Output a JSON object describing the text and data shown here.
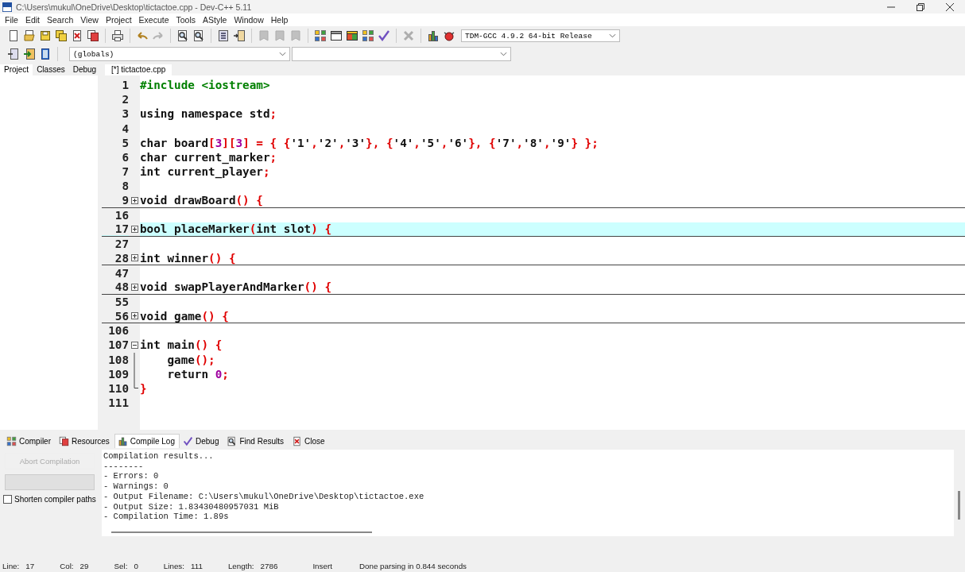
{
  "window": {
    "title": "C:\\Users\\mukul\\OneDrive\\Desktop\\tictactoe.cpp - Dev-C++ 5.11"
  },
  "menu": [
    "File",
    "Edit",
    "Search",
    "View",
    "Project",
    "Execute",
    "Tools",
    "AStyle",
    "Window",
    "Help"
  ],
  "toolbar": [
    {
      "kind": "page",
      "disabled": false
    },
    {
      "kind": "open",
      "disabled": false
    },
    {
      "kind": "save",
      "disabled": false
    },
    {
      "kind": "saveall",
      "disabled": false
    },
    {
      "kind": "closefile",
      "disabled": false
    },
    {
      "kind": "closeall",
      "disabled": false
    },
    {
      "kind": "sep"
    },
    {
      "kind": "print",
      "disabled": false
    },
    {
      "kind": "sep"
    },
    {
      "kind": "undo",
      "disabled": false
    },
    {
      "kind": "redo",
      "disabled": true
    },
    {
      "kind": "sep"
    },
    {
      "kind": "find",
      "disabled": false
    },
    {
      "kind": "find",
      "disabled": false
    },
    {
      "kind": "sep"
    },
    {
      "kind": "lines",
      "disabled": false
    },
    {
      "kind": "indent",
      "disabled": false
    },
    {
      "kind": "sep"
    },
    {
      "kind": "tag",
      "disabled": true
    },
    {
      "kind": "tag",
      "disabled": true
    },
    {
      "kind": "tag",
      "disabled": true
    },
    {
      "kind": "sep"
    },
    {
      "kind": "grid",
      "disabled": false
    },
    {
      "kind": "window",
      "disabled": false
    },
    {
      "kind": "colorwindow",
      "disabled": false
    },
    {
      "kind": "grid",
      "disabled": false
    },
    {
      "kind": "check",
      "disabled": false
    },
    {
      "kind": "sep"
    },
    {
      "kind": "cross",
      "disabled": true
    },
    {
      "kind": "sep"
    },
    {
      "kind": "chart",
      "disabled": false
    },
    {
      "kind": "bug",
      "disabled": false
    }
  ],
  "compiler_select": {
    "value": "TDM-GCC 4.9.2 64-bit Release"
  },
  "toolbar2": [
    {
      "kind": "insert",
      "disabled": false
    },
    {
      "kind": "goto",
      "disabled": false
    },
    {
      "kind": "bookmark",
      "disabled": false
    }
  ],
  "scope_select": {
    "value": "(globals)"
  },
  "left_tabs": [
    {
      "label": "Project",
      "selected": true
    },
    {
      "label": "Classes",
      "selected": false
    },
    {
      "label": "Debug",
      "selected": false
    }
  ],
  "editor_tabs": [
    {
      "label": "[*] tictactoe.cpp",
      "selected": true
    }
  ],
  "code": [
    {
      "n": "1",
      "current": false,
      "seg": [
        {
          "kind": "pre",
          "t": "#include <iostream>"
        }
      ]
    },
    {
      "n": "2",
      "current": false
    },
    {
      "n": "3",
      "current": false,
      "seg": [
        {
          "kind": "plain",
          "t": "using namespace std"
        },
        {
          "kind": "sym",
          "t": ";"
        }
      ]
    },
    {
      "n": "4",
      "current": false
    },
    {
      "n": "5",
      "current": false,
      "seg": [
        {
          "kind": "plain",
          "t": "char board"
        },
        {
          "kind": "sym",
          "t": "["
        },
        {
          "kind": "num",
          "t": "3"
        },
        {
          "kind": "sym",
          "t": "]["
        },
        {
          "kind": "num",
          "t": "3"
        },
        {
          "kind": "sym",
          "t": "] = { {"
        },
        {
          "kind": "plain",
          "t": "'1'"
        },
        {
          "kind": "sym",
          "t": ","
        },
        {
          "kind": "plain",
          "t": "'2'"
        },
        {
          "kind": "sym",
          "t": ","
        },
        {
          "kind": "plain",
          "t": "'3'"
        },
        {
          "kind": "sym",
          "t": "}, {"
        },
        {
          "kind": "plain",
          "t": "'4'"
        },
        {
          "kind": "sym",
          "t": ","
        },
        {
          "kind": "plain",
          "t": "'5'"
        },
        {
          "kind": "sym",
          "t": ","
        },
        {
          "kind": "plain",
          "t": "'6'"
        },
        {
          "kind": "sym",
          "t": "}, {"
        },
        {
          "kind": "plain",
          "t": "'7'"
        },
        {
          "kind": "sym",
          "t": ","
        },
        {
          "kind": "plain",
          "t": "'8'"
        },
        {
          "kind": "sym",
          "t": ","
        },
        {
          "kind": "plain",
          "t": "'9'"
        },
        {
          "kind": "sym",
          "t": "} };"
        }
      ]
    },
    {
      "n": "6",
      "current": false,
      "seg": [
        {
          "kind": "plain",
          "t": "char current_marker"
        },
        {
          "kind": "sym",
          "t": ";"
        }
      ]
    },
    {
      "n": "7",
      "current": false,
      "seg": [
        {
          "kind": "plain",
          "t": "int current_player"
        },
        {
          "kind": "sym",
          "t": ";"
        }
      ]
    },
    {
      "n": "8",
      "current": false
    },
    {
      "n": "9",
      "kind": "collapsed",
      "current": false,
      "seg": [
        {
          "kind": "plain",
          "t": "void drawBoard"
        },
        {
          "kind": "sym",
          "t": "() {"
        }
      ]
    },
    {
      "n": "16",
      "current": false
    },
    {
      "n": "17",
      "kind": "collapsed",
      "current": true,
      "seg": [
        {
          "kind": "plain",
          "t": "bool placeMarker"
        },
        {
          "kind": "sym",
          "t": "("
        },
        {
          "kind": "plain",
          "t": "int slot"
        },
        {
          "kind": "sym",
          "t": ") {"
        }
      ]
    },
    {
      "n": "27",
      "current": false
    },
    {
      "n": "28",
      "kind": "collapsed",
      "current": false,
      "seg": [
        {
          "kind": "plain",
          "t": "int winner"
        },
        {
          "kind": "sym",
          "t": "() {"
        }
      ]
    },
    {
      "n": "47",
      "current": false
    },
    {
      "n": "48",
      "kind": "collapsed",
      "current": false,
      "seg": [
        {
          "kind": "plain",
          "t": "void swapPlayerAndMarker"
        },
        {
          "kind": "sym",
          "t": "() {"
        }
      ]
    },
    {
      "n": "55",
      "current": false
    },
    {
      "n": "56",
      "kind": "collapsed",
      "current": false,
      "seg": [
        {
          "kind": "plain",
          "t": "void game"
        },
        {
          "kind": "sym",
          "t": "() {"
        }
      ]
    },
    {
      "n": "106",
      "current": false
    },
    {
      "n": "107",
      "kind": "expanded",
      "current": false,
      "seg": [
        {
          "kind": "plain",
          "t": "int main"
        },
        {
          "kind": "sym",
          "t": "() {"
        }
      ]
    },
    {
      "n": "108",
      "kind": "body",
      "current": false,
      "seg": [
        {
          "kind": "plain",
          "t": "    game"
        },
        {
          "kind": "sym",
          "t": "();"
        }
      ]
    },
    {
      "n": "109",
      "kind": "body",
      "current": false,
      "seg": [
        {
          "kind": "plain",
          "t": "    return "
        },
        {
          "kind": "num",
          "t": "0"
        },
        {
          "kind": "sym",
          "t": ";"
        }
      ]
    },
    {
      "n": "110",
      "kind": "end",
      "current": false,
      "seg": [
        {
          "kind": "sym",
          "t": "}"
        }
      ]
    },
    {
      "n": "111",
      "current": false
    }
  ],
  "bottom_tabs": [
    {
      "label": "Compiler",
      "selected": false
    },
    {
      "label": "Resources",
      "selected": false
    },
    {
      "label": "Compile Log",
      "selected": true
    },
    {
      "label": "Debug",
      "selected": false
    },
    {
      "label": "Find Results",
      "selected": false
    },
    {
      "label": "Close",
      "selected": false
    }
  ],
  "abort_button": {
    "label": "Abort Compilation",
    "disabled": true
  },
  "progress": {
    "level": 0
  },
  "shorten_paths": {
    "label": "Shorten compiler paths",
    "checked": false
  },
  "log": [
    "Compilation results...",
    "--------",
    "- Errors: 0",
    "- Warnings: 0",
    "- Output Filename: C:\\Users\\mukul\\OneDrive\\Desktop\\tictactoe.exe",
    "- Output Size: 1.83430480957031 MiB",
    "- Compilation Time: 1.89s"
  ],
  "status_bar": {
    "fields": [
      {
        "label": "Line:",
        "value": "17"
      },
      {
        "label": "Col:",
        "value": "29"
      },
      {
        "label": "Sel:",
        "value": "0"
      },
      {
        "label": "Lines:",
        "value": "111"
      },
      {
        "label": "Length:",
        "value": "2786"
      }
    ],
    "mode": "Insert",
    "message": "Done parsing in 0.844 seconds"
  }
}
